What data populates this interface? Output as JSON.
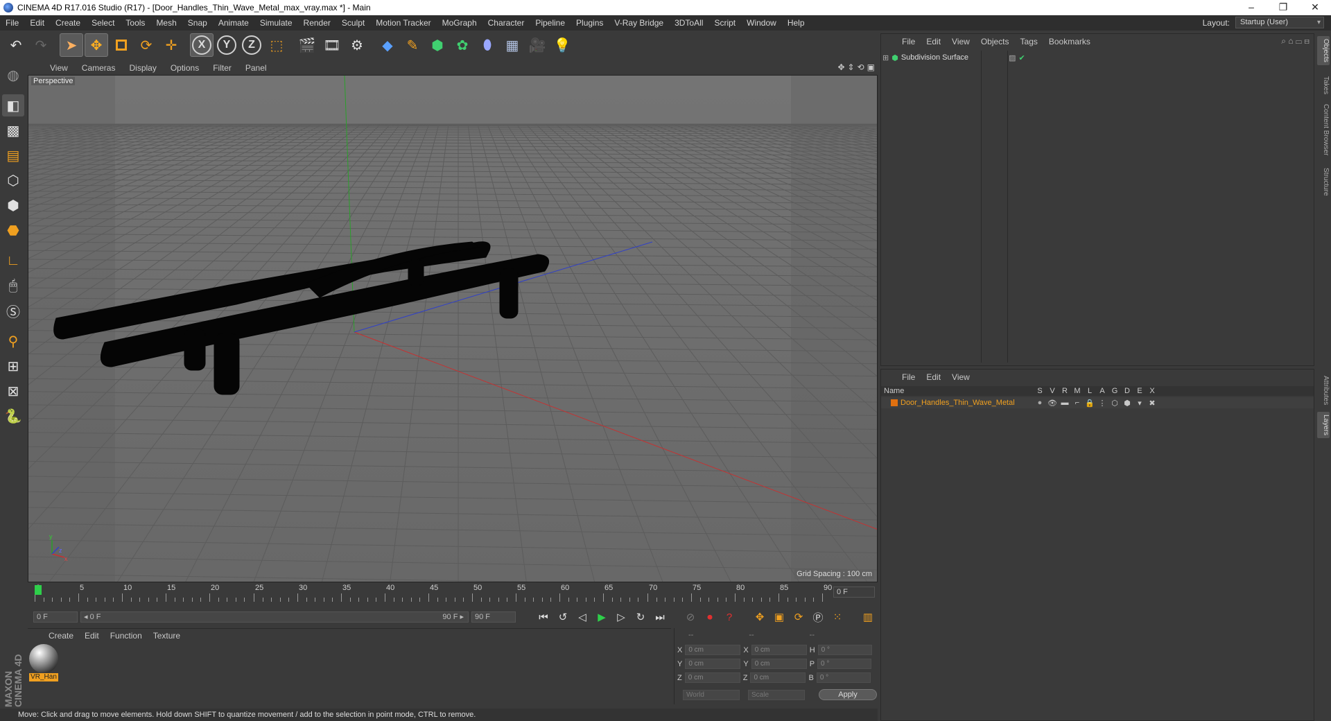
{
  "window": {
    "title": "CINEMA 4D R17.016 Studio (R17) - [Door_Handles_Thin_Wave_Metal_max_vray.max *] - Main",
    "minimize": "–",
    "restore": "❐",
    "close": "✕"
  },
  "menubar": {
    "items": [
      "File",
      "Edit",
      "Create",
      "Select",
      "Tools",
      "Mesh",
      "Snap",
      "Animate",
      "Simulate",
      "Render",
      "Sculpt",
      "Motion Tracker",
      "MoGraph",
      "Character",
      "Pipeline",
      "Plugins",
      "V-Ray Bridge",
      "3DToAll",
      "Script",
      "Window",
      "Help"
    ],
    "layout_label": "Layout:",
    "layout_value": "Startup (User)"
  },
  "toolbar": {
    "axis_x": "X",
    "axis_y": "Y",
    "axis_z": "Z"
  },
  "viewport": {
    "menu": [
      "View",
      "Cameras",
      "Display",
      "Options",
      "Filter",
      "Panel"
    ],
    "camera_label": "Perspective",
    "grid_spacing": "Grid Spacing : 100 cm"
  },
  "timeline": {
    "ticks": [
      "0",
      "5",
      "10",
      "15",
      "20",
      "25",
      "30",
      "35",
      "40",
      "45",
      "50",
      "55",
      "60",
      "65",
      "70",
      "75",
      "80",
      "85",
      "90"
    ],
    "current_frame": "0 F"
  },
  "playbar": {
    "start_field": "0 F",
    "range_start": "◂ 0 F",
    "range_end": "90 F ▸",
    "end_field": "90 F"
  },
  "material_panel": {
    "menu": [
      "Create",
      "Edit",
      "Function",
      "Texture"
    ],
    "material_name": "VR_Han"
  },
  "coord_panel": {
    "headers": [
      "--",
      "--",
      "--"
    ],
    "rows": [
      {
        "l1": "X",
        "v1": "0 cm",
        "l2": "X",
        "v2": "0 cm",
        "l3": "H",
        "v3": "0 °"
      },
      {
        "l1": "Y",
        "v1": "0 cm",
        "l2": "Y",
        "v2": "0 cm",
        "l3": "P",
        "v3": "0 °"
      },
      {
        "l1": "Z",
        "v1": "0 cm",
        "l2": "Z",
        "v2": "0 cm",
        "l3": "B",
        "v3": "0 °"
      }
    ],
    "world_select": "World",
    "scale_select": "Scale",
    "apply_label": "Apply"
  },
  "object_manager": {
    "menu": [
      "File",
      "Edit",
      "View",
      "Objects",
      "Tags",
      "Bookmarks"
    ],
    "object_name": "Subdivision Surface"
  },
  "layer_manager": {
    "menu": [
      "File",
      "Edit",
      "View"
    ],
    "columns": [
      "Name",
      "S",
      "V",
      "R",
      "M",
      "L",
      "A",
      "G",
      "D",
      "E",
      "X"
    ],
    "layer_name": "Door_Handles_Thin_Wave_Metal",
    "layer_color": "#e07010"
  },
  "right_tabs": [
    "Objects",
    "Takes",
    "Content Browser",
    "Structure",
    "Attributes",
    "Layers"
  ],
  "statusbar": {
    "text": "Move: Click and drag to move elements. Hold down SHIFT to quantize movement / add to the selection in point mode, CTRL to remove."
  },
  "branding": {
    "logo_text": "MAXON CINEMA 4D"
  }
}
